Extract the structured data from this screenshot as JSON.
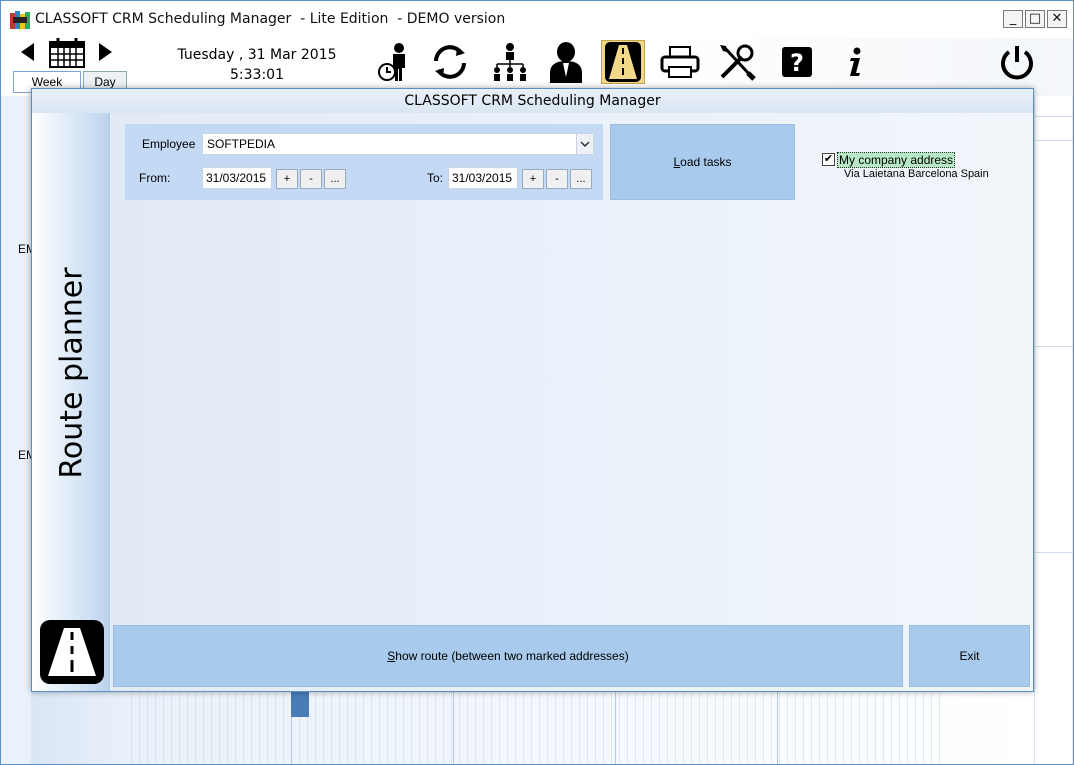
{
  "window": {
    "title": "CLASSOFT CRM Scheduling Manager  - Lite Edition  - DEMO version",
    "controls": {
      "minimize": "_",
      "maximize": "□",
      "close": "✕"
    }
  },
  "toolbar": {
    "date": "Tuesday ,  31 Mar 2015",
    "time": "5:33:01",
    "tabs": {
      "week": "Week",
      "day": "Day"
    },
    "icons": [
      "prev-arrow-icon",
      "calendar-icon",
      "next-arrow-icon",
      "employee-clock-icon",
      "sync-icon",
      "org-chart-icon",
      "contact-icon",
      "road-icon",
      "printer-icon",
      "tools-icon",
      "help-icon",
      "info-icon",
      "power-icon"
    ]
  },
  "background": {
    "row_labels": [
      "EM",
      "EM"
    ]
  },
  "dialog": {
    "title": "CLASSOFT CRM Scheduling Manager",
    "side_label": "Route planner",
    "employee": {
      "label": "Employee",
      "value": "SOFTPEDIA"
    },
    "from": {
      "label": "From:",
      "value": "31/03/2015"
    },
    "to": {
      "label": "To:",
      "value": "31/03/2015"
    },
    "buttons": {
      "plus": "+",
      "minus": "-",
      "ellipsis": "..."
    },
    "load_tasks": {
      "accel": "L",
      "rest": "oad tasks"
    },
    "company": {
      "label": "My company address",
      "address": "Via Laietana Barcelona Spain",
      "checked": true
    },
    "show_route": {
      "accel": "S",
      "rest": "how route (between two  marked addresses)"
    },
    "exit": "Exit"
  },
  "colors": {
    "accent": "#a8cbed",
    "active_tool": "#f2d98a",
    "company_highlight": "#b7e8c6"
  }
}
